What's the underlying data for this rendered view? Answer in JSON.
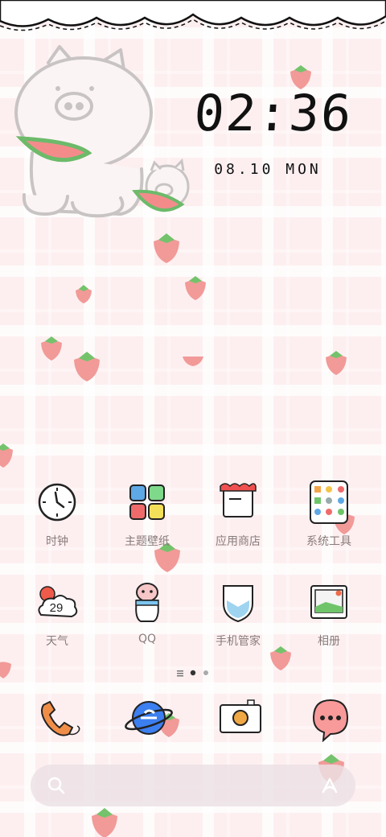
{
  "lockscreen_clock": {
    "time": "02:36",
    "date": "08.10 MON"
  },
  "apps_row1": [
    {
      "label": "时钟",
      "icon": "clock-icon"
    },
    {
      "label": "主题壁纸",
      "icon": "theme-wallpaper-icon"
    },
    {
      "label": "应用商店",
      "icon": "app-store-icon"
    },
    {
      "label": "系统工具",
      "icon": "system-tools-folder-icon"
    }
  ],
  "apps_row2": [
    {
      "label": "天气",
      "icon": "weather-icon",
      "badge": "29"
    },
    {
      "label": "QQ",
      "icon": "qq-penguin-icon"
    },
    {
      "label": "手机管家",
      "icon": "phone-manager-shield-icon"
    },
    {
      "label": "相册",
      "icon": "gallery-icon"
    }
  ],
  "page_indicator": {
    "pages": 2,
    "current": 1,
    "has_menu_page": true
  },
  "dock": [
    {
      "icon": "phone-icon"
    },
    {
      "icon": "browser-icon"
    },
    {
      "icon": "camera-icon"
    },
    {
      "icon": "messages-icon"
    }
  ],
  "search_bar": {
    "left_icon": "search-icon",
    "right_icon": "assistant-icon"
  },
  "colors": {
    "background": "#fdeff0",
    "strawberry": "#f08a8a",
    "leaf": "#6fc46a",
    "label": "#8a7b7b"
  }
}
